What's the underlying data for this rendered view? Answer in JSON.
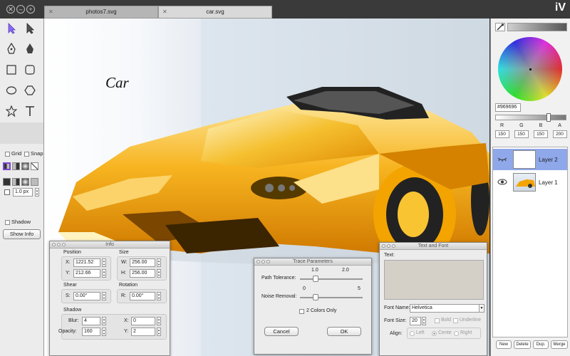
{
  "window": {
    "close": "✕",
    "minimize": "–",
    "maximize": "+",
    "logo": "iV"
  },
  "tabs": [
    {
      "label": "photos7.svg"
    },
    {
      "label": "car.svg"
    }
  ],
  "canvas": {
    "text": "Car"
  },
  "toolbox": {
    "grid_label": "Grid",
    "snap_label": "Snap",
    "stroke_width": "1.0 px",
    "shadow_label": "Shadow",
    "show_info_label": "Show Info"
  },
  "color": {
    "hex": "#969696",
    "labels": [
      "R",
      "G",
      "B",
      "A"
    ],
    "values": [
      "150",
      "150",
      "150",
      "200"
    ]
  },
  "layers": [
    {
      "name": "Layer 2"
    },
    {
      "name": "Layer 1"
    }
  ],
  "layer_buttons": {
    "new": "New",
    "delete": "Delete",
    "dup": "Dup.",
    "merge": "Merge"
  },
  "info": {
    "title": "Info",
    "position_label": "Position",
    "size_label": "Size",
    "x_label": "X:",
    "x_value": "1221.52",
    "y_label": "Y:",
    "y_value": "212.66",
    "w_label": "W:",
    "w_value": "256.00",
    "h_label": "H:",
    "h_value": "256.00",
    "shear_label": "Shear",
    "rotation_label": "Rotation",
    "s_label": "S:",
    "s_value": "0.00°",
    "r_label": "R:",
    "r_value": "0.00°",
    "shadow_label": "Shadow",
    "blur_label": "Blur:",
    "blur_value": "4",
    "opacity_label": "Opacity:",
    "opacity_value": "160",
    "sx_label": "X:",
    "sx_value": "0",
    "sy_label": "Y:",
    "sy_value": "2"
  },
  "trace": {
    "title": "Trace Parameters",
    "tolerance_label": "Path Tolerance:",
    "tol_min": "1.0",
    "tol_max": "2.0",
    "tolerance_value": 0.25,
    "noise_label": "Noise Removal:",
    "noise_min": "0",
    "noise_max": "5",
    "noise_value": 0.25,
    "two_colors_label": "2 Colors Only",
    "cancel": "Cancel",
    "ok": "OK"
  },
  "textfont": {
    "title": "Text and Font",
    "text_label": "Text:",
    "font_name_label": "Font Name:",
    "font_name": "Helvetica",
    "font_size_label": "Font Size:",
    "font_size": "20",
    "bold": "Bold",
    "underline": "Underline",
    "align_label": "Align:",
    "left": "Left",
    "center": "Cente",
    "right": "Right"
  }
}
